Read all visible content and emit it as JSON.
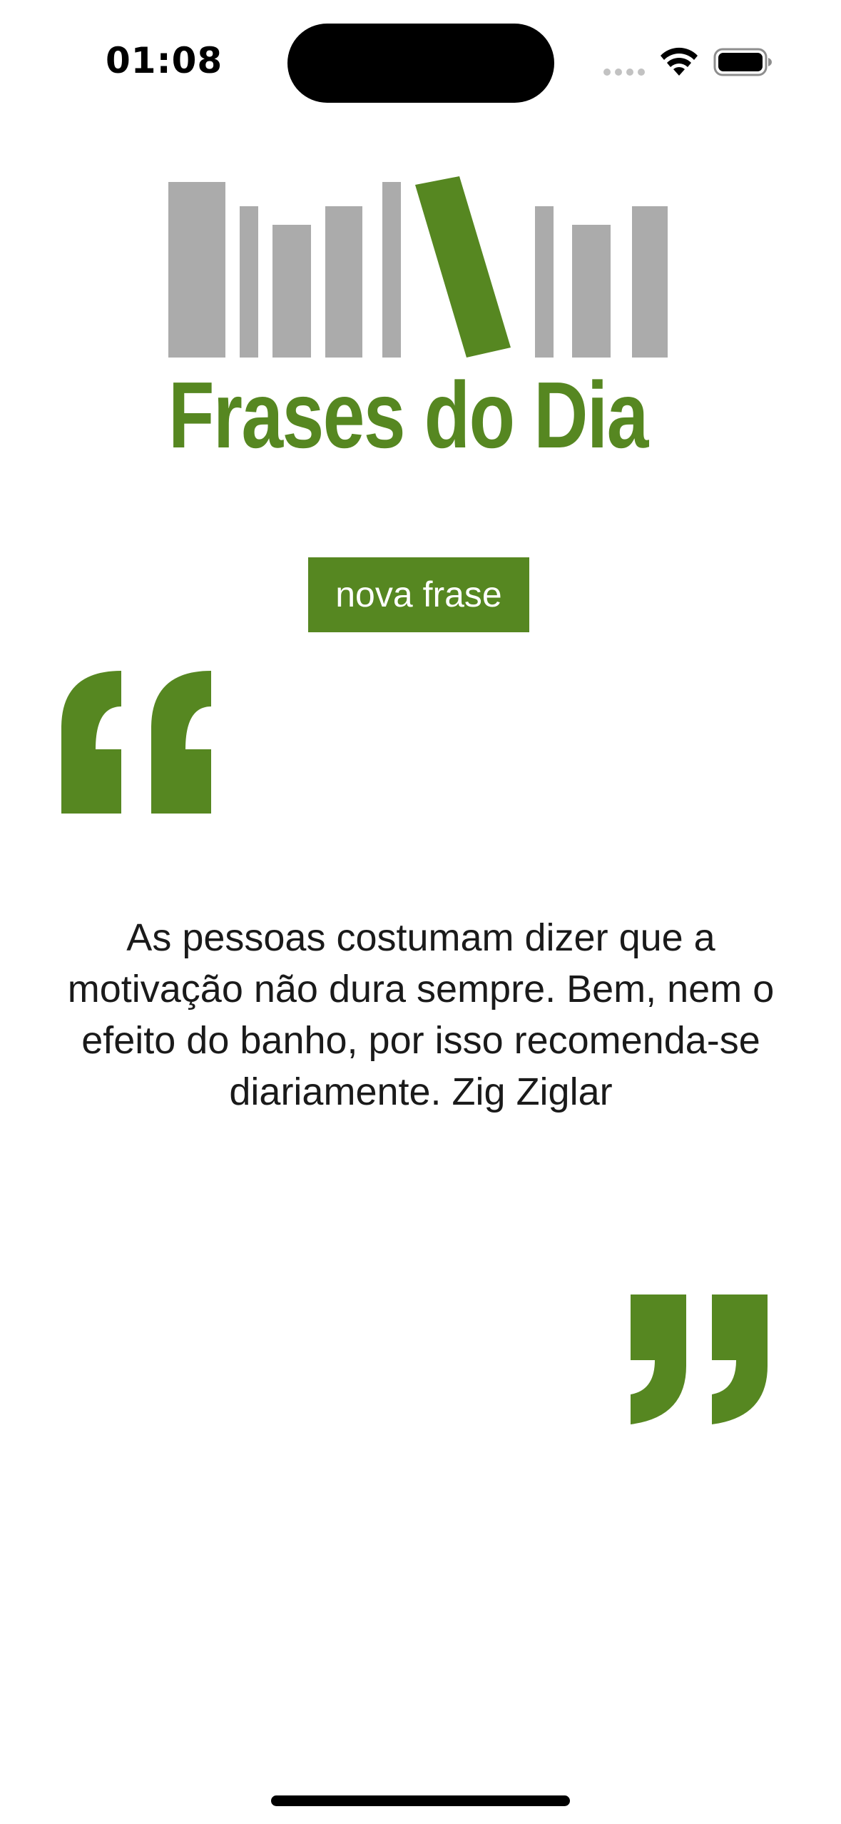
{
  "status_bar": {
    "time": "01:08"
  },
  "logo": {
    "text": "Frases do Dia",
    "icon": "books-logo"
  },
  "actions": {
    "new_quote_label": "nova frase"
  },
  "quote": {
    "text": "As pessoas costumam dizer que a motivação não dura sempre. Bem, nem o efeito do banho, por isso recomenda-se diariamente. Zig Ziglar"
  },
  "colors": {
    "brand_green": "#568721",
    "book_gray": "#ababab",
    "background": "#ffffff",
    "text": "#1a1a1a"
  }
}
